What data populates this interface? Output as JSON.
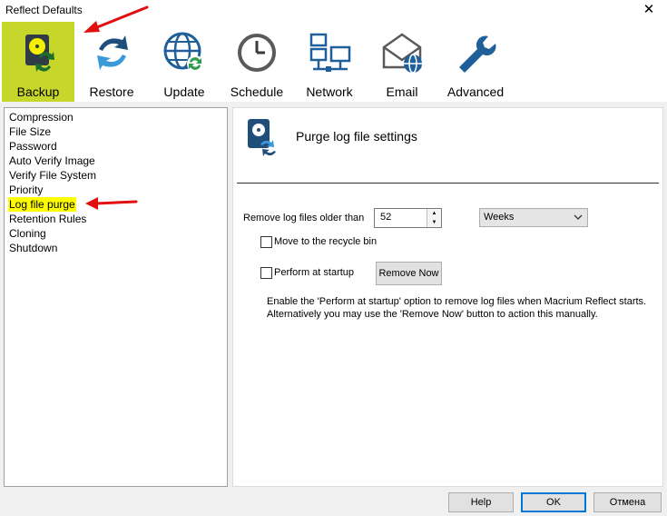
{
  "window": {
    "title": "Reflect Defaults",
    "close_glyph": "✕"
  },
  "toolbar": {
    "items": [
      {
        "label": "Backup",
        "icon": "backup-disk-icon",
        "selected": true
      },
      {
        "label": "Restore",
        "icon": "restore-arrows-icon"
      },
      {
        "label": "Update",
        "icon": "update-globe-icon"
      },
      {
        "label": "Schedule",
        "icon": "clock-icon"
      },
      {
        "label": "Network",
        "icon": "network-icon"
      },
      {
        "label": "Email",
        "icon": "email-icon"
      },
      {
        "label": "Advanced",
        "icon": "wrench-icon"
      }
    ],
    "highlight_color": "#c6d62a"
  },
  "sidebar": {
    "items": [
      {
        "label": "Compression"
      },
      {
        "label": "File Size"
      },
      {
        "label": "Password"
      },
      {
        "label": "Auto Verify Image"
      },
      {
        "label": "Verify File System"
      },
      {
        "label": "Priority"
      },
      {
        "label": "Log file purge",
        "selected": true
      },
      {
        "label": "Retention Rules"
      },
      {
        "label": "Cloning"
      },
      {
        "label": "Shutdown"
      }
    ],
    "highlight_color": "#ffff00"
  },
  "panel": {
    "header": "Purge log file settings",
    "remove_label": "Remove log files older than",
    "remove_value": "52",
    "unit_selected": "Weeks",
    "recycle_label": "Move to the recycle bin",
    "recycle_checked": false,
    "startup_label": "Perform at startup",
    "startup_checked": false,
    "remove_now_label": "Remove Now",
    "info_line1": "Enable the 'Perform at startup' option to remove log files when Macrium Reflect starts.",
    "info_line2": "Alternatively you may use the 'Remove Now' button to action this manually."
  },
  "footer": {
    "help_label": "Help",
    "ok_label": "OK",
    "cancel_label": "Отмена"
  },
  "colors": {
    "annotation_arrow": "#e01010",
    "accent_blue": "#1e6fb8"
  }
}
